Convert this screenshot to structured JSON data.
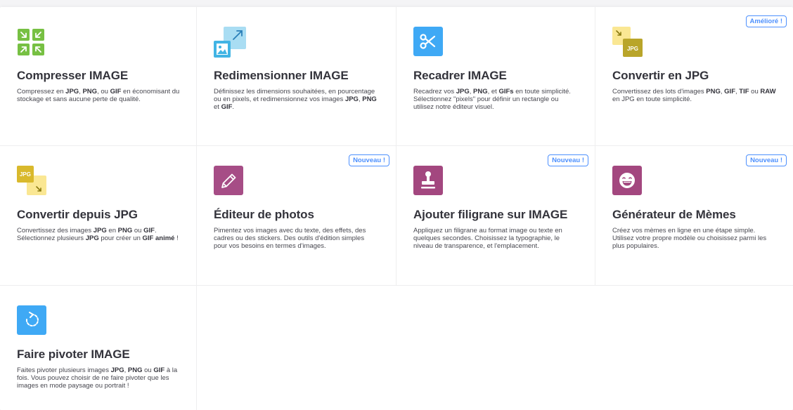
{
  "colors": {
    "compress": "#77c043",
    "resize": "#41b4e4",
    "crop": "#3fa9f5",
    "jpg_yellow": "#f5d33a",
    "jpg_olive": "#b9a52a",
    "editor": "#a64d86",
    "watermark": "#a3477f",
    "meme": "#a3477f",
    "rotate": "#3fa9f5",
    "badge": "#4d90fe"
  },
  "tools": [
    {
      "icon": "compress-arrows-icon",
      "title": "Compresser IMAGE",
      "badge": "",
      "desc": [
        {
          "t": "Compressez en "
        },
        {
          "t": "JPG",
          "b": true
        },
        {
          "t": ", "
        },
        {
          "t": "PNG",
          "b": true
        },
        {
          "t": ", ou "
        },
        {
          "t": "GIF",
          "b": true
        },
        {
          "t": " en économisant du stockage et sans aucune perte de qualité."
        }
      ]
    },
    {
      "icon": "resize-image-icon",
      "title": "Redimensionner IMAGE",
      "badge": "",
      "desc": [
        {
          "t": "Définissez les dimensions souhaitées, en pourcentage ou en pixels, et redimensionnez vos images "
        },
        {
          "t": "JPG",
          "b": true
        },
        {
          "t": ", "
        },
        {
          "t": "PNG",
          "b": true
        },
        {
          "t": " et "
        },
        {
          "t": "GIF",
          "b": true
        },
        {
          "t": "."
        }
      ]
    },
    {
      "icon": "scissors-icon",
      "title": "Recadrer IMAGE",
      "badge": "",
      "desc": [
        {
          "t": "Recadrez vos "
        },
        {
          "t": "JPG",
          "b": true
        },
        {
          "t": ", "
        },
        {
          "t": "PNG",
          "b": true
        },
        {
          "t": ", et "
        },
        {
          "t": "GIFs",
          "b": true
        },
        {
          "t": " en toute simplicité. Sélectionnez \"pixels\" pour définir un rectangle ou utilisez notre éditeur visuel."
        }
      ]
    },
    {
      "icon": "convert-to-jpg-icon",
      "title": "Convertir en JPG",
      "badge": "Amélioré !",
      "jpg_label": "JPG",
      "desc": [
        {
          "t": "Convertissez des lots d'images "
        },
        {
          "t": "PNG",
          "b": true
        },
        {
          "t": ", "
        },
        {
          "t": "GIF",
          "b": true
        },
        {
          "t": ", "
        },
        {
          "t": "TIF",
          "b": true
        },
        {
          "t": " ou "
        },
        {
          "t": "RAW",
          "b": true
        },
        {
          "t": " en JPG en toute simplicité."
        }
      ]
    },
    {
      "icon": "convert-from-jpg-icon",
      "title": "Convertir depuis JPG",
      "badge": "",
      "jpg_label": "JPG",
      "desc": [
        {
          "t": "Convertissez des images "
        },
        {
          "t": "JPG",
          "b": true
        },
        {
          "t": " en "
        },
        {
          "t": "PNG",
          "b": true
        },
        {
          "t": " ou "
        },
        {
          "t": "GIF",
          "b": true
        },
        {
          "t": ". Sélectionnez plusieurs "
        },
        {
          "t": "JPG",
          "b": true
        },
        {
          "t": " pour créer un "
        },
        {
          "t": "GIF animé",
          "b": true
        },
        {
          "t": " !"
        }
      ]
    },
    {
      "icon": "pencil-icon",
      "title": "Éditeur de photos",
      "badge": "Nouveau !",
      "desc": [
        {
          "t": "Pimentez vos images avec du texte, des effets, des cadres ou des stickers. Des outils d'édition simples pour vos besoins en termes d'images."
        }
      ]
    },
    {
      "icon": "stamp-icon",
      "title": "Ajouter filigrane sur IMAGE",
      "badge": "Nouveau !",
      "desc": [
        {
          "t": "Appliquez un filigrane au format image ou texte en quelques secondes. Choisissez la typographie, le niveau de transparence, et l'emplacement."
        }
      ]
    },
    {
      "icon": "laughing-face-icon",
      "title": "Générateur de Mèmes",
      "badge": "Nouveau !",
      "desc": [
        {
          "t": "Créez vos mèmes en ligne en une étape simple. Utilisez votre propre modèle ou choisissez parmi les plus populaires."
        }
      ]
    },
    {
      "icon": "rotate-icon",
      "title": "Faire pivoter IMAGE",
      "badge": "",
      "desc": [
        {
          "t": "Faites pivoter plusieurs images "
        },
        {
          "t": "JPG",
          "b": true
        },
        {
          "t": ", "
        },
        {
          "t": "PNG",
          "b": true
        },
        {
          "t": " ou "
        },
        {
          "t": "GIF",
          "b": true
        },
        {
          "t": " à la fois. Vous pouvez choisir de ne faire pivoter que les images en mode paysage ou portrait !"
        }
      ]
    }
  ]
}
